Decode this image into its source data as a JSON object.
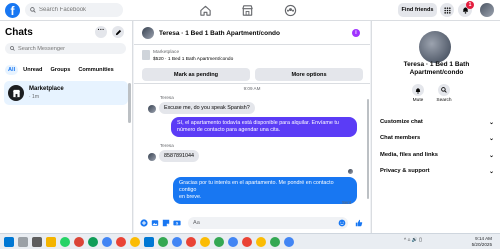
{
  "topbar": {
    "logo_letter": "f",
    "search_placeholder": "Search Facebook",
    "find_friends": "Find friends",
    "notif_count": "1"
  },
  "sidebar": {
    "title": "Chats",
    "more_glyph": "···",
    "search_placeholder": "Search Messenger",
    "filters": [
      "All",
      "Unread",
      "Groups",
      "Communities"
    ],
    "chat": {
      "name": "Marketplace",
      "subtitle": "· 1m"
    }
  },
  "conversation": {
    "title": "Teresa · 1 Bed 1 Bath Apartment/condo",
    "info_glyph": "i",
    "listing_label": "Marketplace",
    "listing_line": "$520 · 1 Bed 1 Bath Apartment/condo",
    "mark_pending": "Mark as pending",
    "more_options": "More options",
    "time_divider": "9:09 AM",
    "messages": [
      {
        "sender": "Teresa",
        "text": "Excuse me, do you speak Spanish?"
      },
      {
        "text_line1": "Sí, el apartamento todavía está disponible para alquilar. Envíame tu",
        "text_line2": "número de contacto para agendar una cita."
      },
      {
        "sender": "Teresa",
        "text": "8587891044"
      },
      {
        "text_line1": "Gracias por tu interés en el apartamento. Me pondré en contacto contigo",
        "text_line2": "en breve."
      }
    ],
    "sent_label": "Sent",
    "composer_placeholder": "Aa"
  },
  "right_panel": {
    "title_line1": "Teresa · 1 Bed 1 Bath",
    "title_line2": "Apartment/condo",
    "mute": "Mute",
    "search": "Search",
    "rows": [
      "Customize chat",
      "Chat members",
      "Media, files and links",
      "Privacy & support"
    ],
    "chevron": "⌄"
  },
  "taskbar": {
    "time": "9:14 AM",
    "date": "5/20/2025",
    "systray": "^  ⌂  🔊  ▯"
  },
  "colors": {
    "accent": "#1877f2",
    "bubble_purple": "#5b3cf6",
    "badge_red": "#e41e3f"
  }
}
